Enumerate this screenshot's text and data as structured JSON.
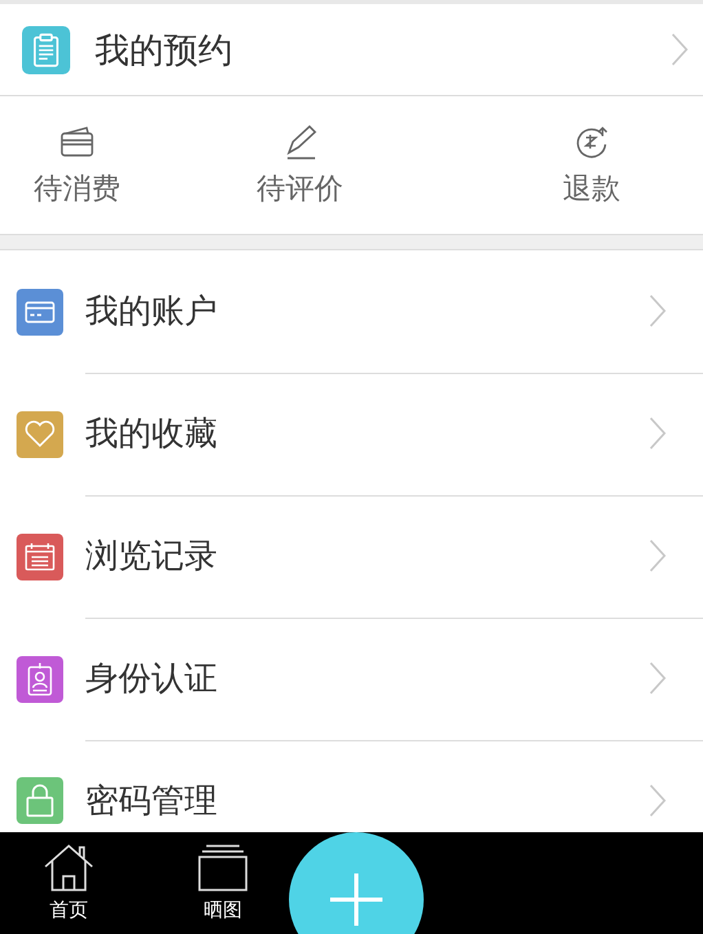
{
  "appointments": {
    "title": "我的预约",
    "actions": [
      {
        "label": "待消费"
      },
      {
        "label": "待评价"
      },
      {
        "label": "退款"
      }
    ]
  },
  "menu": [
    {
      "label": "我的账户",
      "color": "#5b8fd6"
    },
    {
      "label": "我的收藏",
      "color": "#d4a84f"
    },
    {
      "label": "浏览记录",
      "color": "#d95a5a"
    },
    {
      "label": "身份认证",
      "color": "#c05ad6"
    },
    {
      "label": "密码管理",
      "color": "#6cc47a"
    }
  ],
  "tab_bar": {
    "items": [
      {
        "label": "首页"
      },
      {
        "label": "晒图"
      }
    ]
  }
}
